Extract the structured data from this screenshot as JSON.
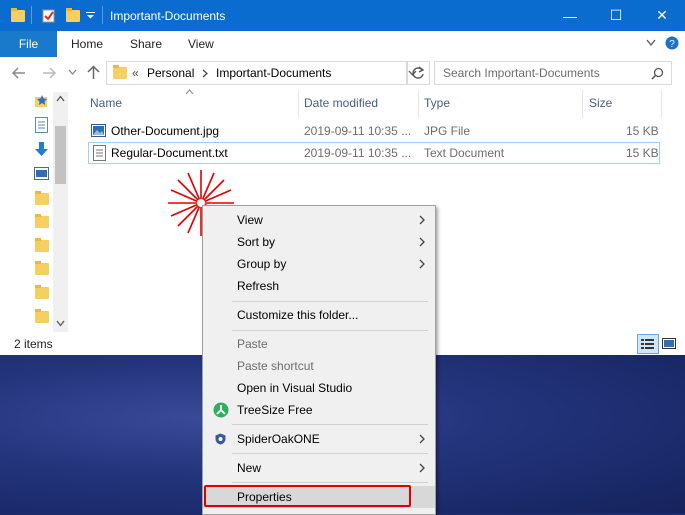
{
  "window": {
    "title": "Important-Documents",
    "controls": {
      "minimize": "—",
      "maximize": "☐",
      "close": "✕"
    }
  },
  "ribbon": {
    "file_tab": "File",
    "tabs": [
      "Home",
      "Share",
      "View"
    ]
  },
  "address_bar": {
    "chevron": "«",
    "breadcrumb": [
      "Personal",
      "Important-Documents"
    ]
  },
  "search": {
    "placeholder": "Search Important-Documents"
  },
  "columns": {
    "name": "Name",
    "date": "Date modified",
    "type": "Type",
    "size": "Size"
  },
  "files": [
    {
      "name": "Other-Document.jpg",
      "date": "2019-09-11 10:35 ...",
      "type": "JPG File",
      "size": "15 KB",
      "icon": "image-file-icon"
    },
    {
      "name": "Regular-Document.txt",
      "date": "2019-09-11 10:35 ...",
      "type": "Text Document",
      "size": "15 KB",
      "icon": "text-file-icon"
    }
  ],
  "status": {
    "items": "2 items"
  },
  "context_menu": {
    "view": "View",
    "sort_by": "Sort by",
    "group_by": "Group by",
    "refresh": "Refresh",
    "customize": "Customize this folder...",
    "paste": "Paste",
    "paste_shortcut": "Paste shortcut",
    "open_vs": "Open in Visual Studio",
    "treesize": "TreeSize Free",
    "spideroak": "SpiderOakONE",
    "new": "New",
    "properties": "Properties"
  },
  "colors": {
    "titlebar": "#0b6ccf",
    "file_tab": "#1979ca",
    "highlight": "#e00000"
  }
}
